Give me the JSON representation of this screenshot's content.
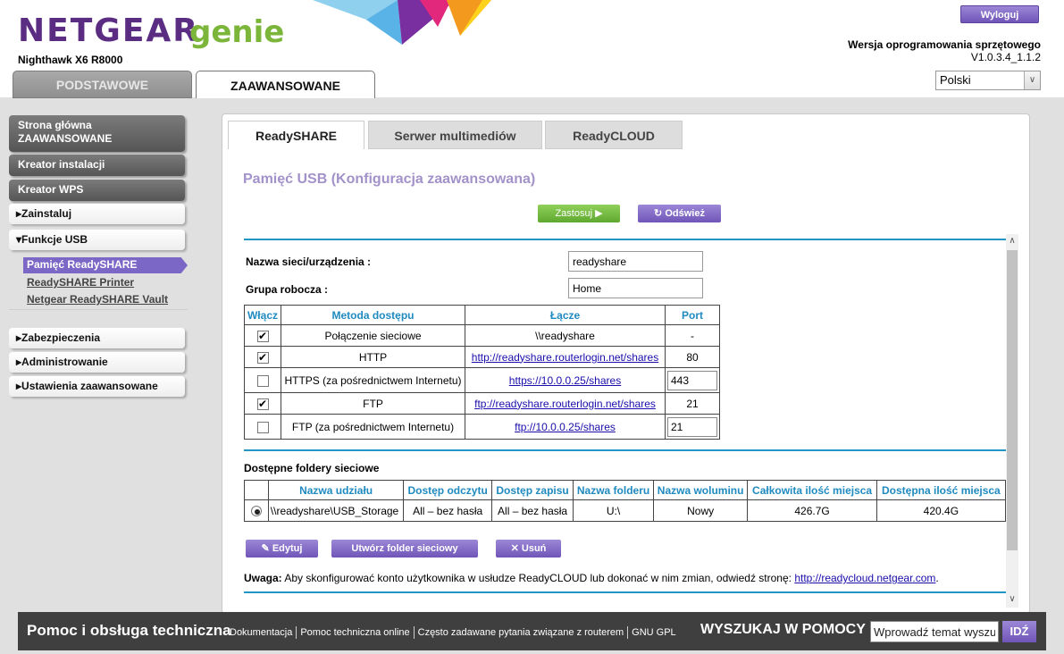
{
  "header": {
    "logo_netgear": "NETGEAR",
    "logo_genie": "genie",
    "model": "Nighthawk X6 R8000",
    "logout": "Wyloguj",
    "firmware_label": "Wersja oprogramowania sprzętowego",
    "firmware_version": "V1.0.3.4_1.1.2",
    "language": "Polski"
  },
  "main_tabs": {
    "basic": "PODSTAWOWE",
    "advanced": "ZAAWANSOWANE"
  },
  "sidebar": {
    "home": "Strona główna ZAAWANSOWANE",
    "setup_wizard": "Kreator instalacji",
    "wps_wizard": "Kreator WPS",
    "setup": "Zainstaluj",
    "usb_functions": "Funkcje USB",
    "usb_sub": [
      "Pamięć ReadySHARE",
      "ReadySHARE Printer",
      "Netgear ReadySHARE Vault"
    ],
    "security": "Zabezpieczenia",
    "administration": "Administrowanie",
    "advanced_setup": "Ustawienia zaawansowane"
  },
  "subtabs": [
    "ReadySHARE",
    "Serwer multimediów",
    "ReadyCLOUD"
  ],
  "page_title": "Pamięć USB (Konfiguracja zaawansowana)",
  "buttons": {
    "apply": "Zastosuj",
    "refresh": "Odśwież",
    "edit": "Edytuj",
    "create_folder": "Utwórz folder sieciowy",
    "delete": "Usuń"
  },
  "form": {
    "device_name_label": "Nazwa sieci/urządzenia :",
    "device_name_value": "readyshare",
    "workgroup_label": "Grupa robocza :",
    "workgroup_value": "Home"
  },
  "access_table": {
    "headers": [
      "Włącz",
      "Metoda dostępu",
      "Łącze",
      "Port"
    ],
    "rows": [
      {
        "enabled": true,
        "method": "Połączenie sieciowe",
        "link": "\\\\readyshare",
        "port": "-"
      },
      {
        "enabled": true,
        "method": "HTTP",
        "link": "http://readyshare.routerlogin.net/shares",
        "port": "80"
      },
      {
        "enabled": false,
        "method": "HTTPS (za pośrednictwem Internetu)",
        "link": "https://10.0.0.25/shares",
        "port": "443"
      },
      {
        "enabled": true,
        "method": "FTP",
        "link": "ftp://readyshare.routerlogin.net/shares",
        "port": "21"
      },
      {
        "enabled": false,
        "method": "FTP (za pośrednictwem Internetu)",
        "link": "ftp://10.0.0.25/shares",
        "port": "21"
      }
    ]
  },
  "folders": {
    "title": "Dostępne foldery sieciowe",
    "headers": [
      "",
      "Nazwa udziału",
      "Dostęp odczytu",
      "Dostęp zapisu",
      "Nazwa folderu",
      "Nazwa woluminu",
      "Całkowita ilość miejsca",
      "Dostępna ilość miejsca"
    ],
    "rows": [
      {
        "share": "\\\\readyshare\\USB_Storage",
        "read": "All – bez hasła",
        "write": "All – bez hasła",
        "folder": "U:\\",
        "volume": "Nowy",
        "total": "426.7G",
        "free": "420.4G"
      }
    ]
  },
  "note": {
    "label": "Uwaga:",
    "text": "Aby skonfigurować konto użytkownika w usłudze ReadyCLOUD lub dokonać w nim zmian, odwiedź stronę:",
    "link": "http://readycloud.netgear.com",
    "end": "."
  },
  "footer": {
    "title": "Pomoc i obsługa techniczna",
    "links": [
      "Dokumentacja",
      "Pomoc techniczna online",
      "Często zadawane pytania związane z routerem",
      "GNU GPL"
    ],
    "search_label": "WYSZUKAJ W POMOCY",
    "search_placeholder": "Wprowadź temat wyszu",
    "go": "IDŹ"
  }
}
